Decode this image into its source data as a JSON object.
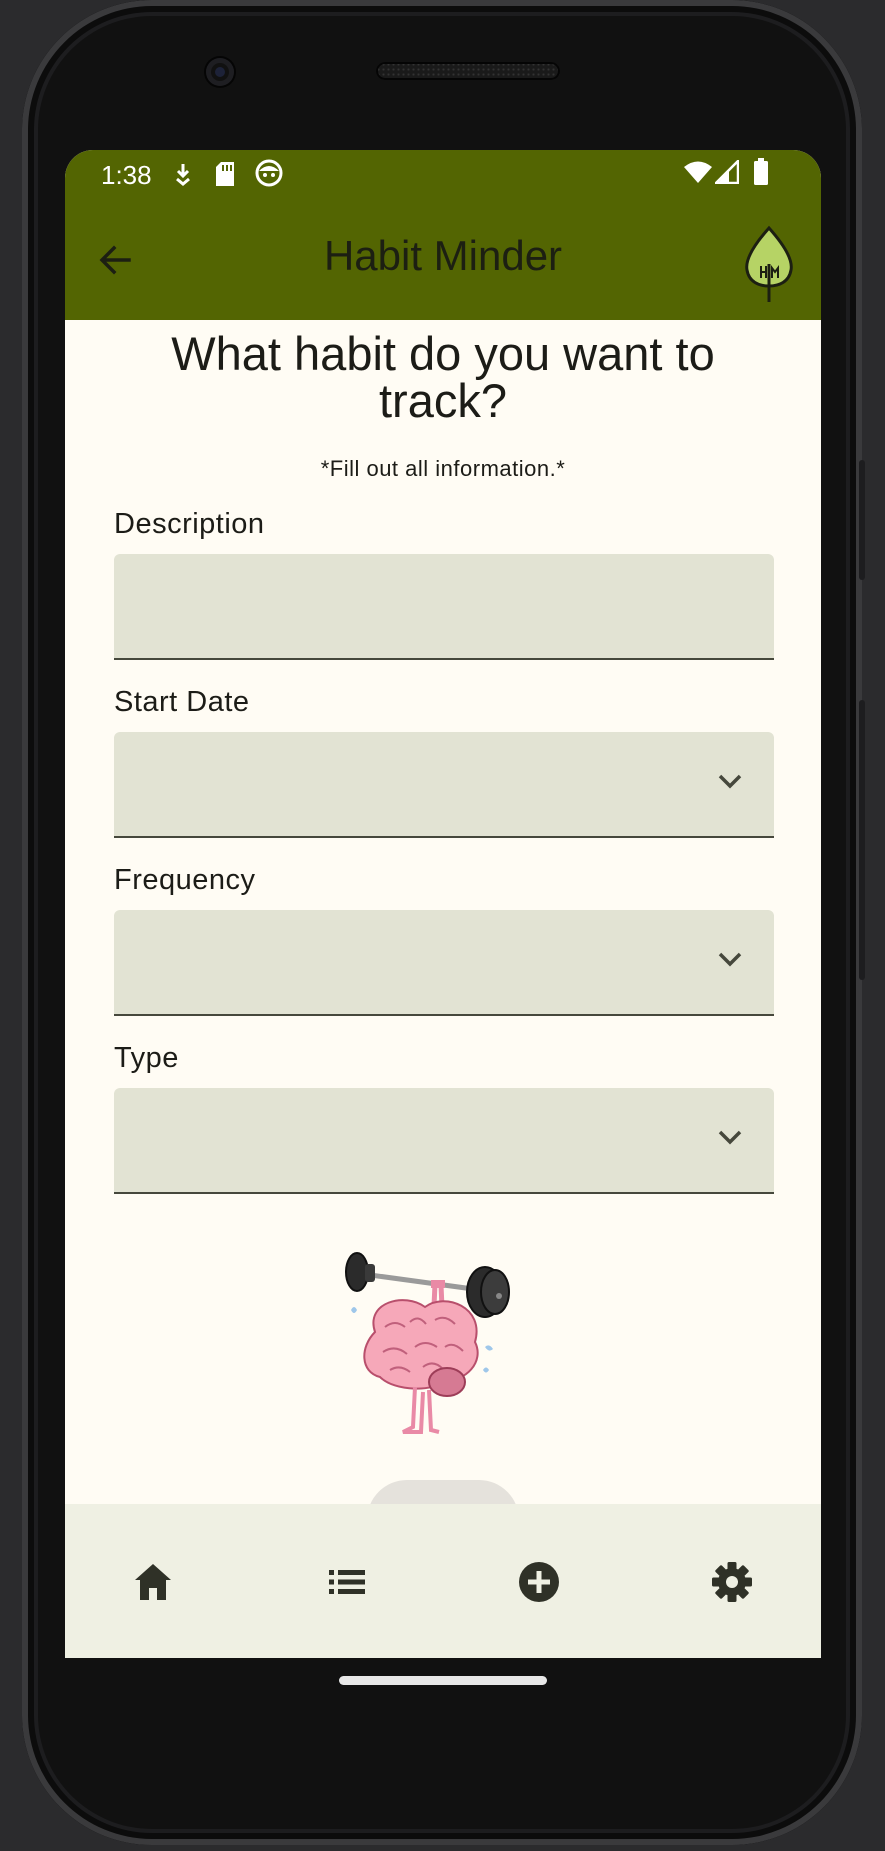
{
  "status_bar": {
    "time": "1:38",
    "left_icons": [
      "download-icon",
      "sd-card-icon",
      "face-notification-icon"
    ],
    "right_icons": [
      "wifi-icon",
      "signal-icon",
      "battery-icon"
    ]
  },
  "app_bar": {
    "title": "Habit Minder",
    "back_icon": "arrow-back-icon",
    "logo_icon": "leaf-logo-icon"
  },
  "form": {
    "heading": "What habit do you want to track?",
    "note": "*Fill out all information.*",
    "fields": [
      {
        "label": "Description",
        "value": "",
        "type": "text"
      },
      {
        "label": "Start Date",
        "value": "",
        "type": "dropdown"
      },
      {
        "label": "Frequency",
        "value": "",
        "type": "dropdown"
      },
      {
        "label": "Type",
        "value": "",
        "type": "dropdown"
      }
    ],
    "illustration": "brain-lifting-barbell-illustration"
  },
  "bottom_nav": {
    "items": [
      "home-icon",
      "list-icon",
      "add-circle-icon",
      "settings-icon"
    ]
  },
  "colors": {
    "primary": "#536502",
    "background": "#fffcf4",
    "field_fill": "#e2e3d3",
    "nav_background": "#eff0e3"
  }
}
